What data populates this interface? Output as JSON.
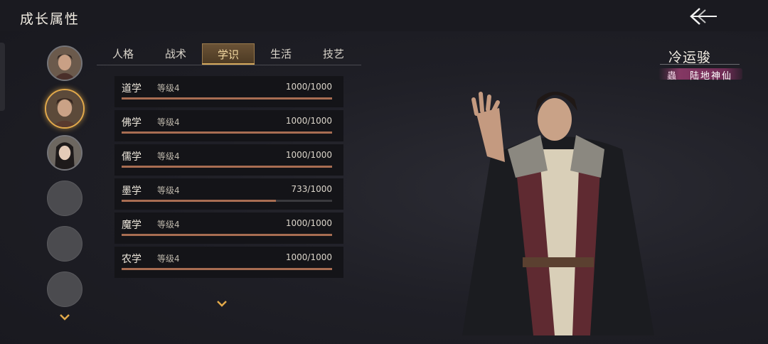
{
  "header": {
    "title": "成长属性"
  },
  "tabs": [
    {
      "label": "人格",
      "active": false
    },
    {
      "label": "战术",
      "active": false
    },
    {
      "label": "学识",
      "active": true
    },
    {
      "label": "生活",
      "active": false
    },
    {
      "label": "技艺",
      "active": false
    }
  ],
  "attributes": [
    {
      "name": "道学",
      "level": "等级4",
      "value": "1000/1000",
      "progress": 1.0
    },
    {
      "name": "佛学",
      "level": "等级4",
      "value": "1000/1000",
      "progress": 1.0
    },
    {
      "name": "儒学",
      "level": "等级4",
      "value": "1000/1000",
      "progress": 1.0
    },
    {
      "name": "墨学",
      "level": "等级4",
      "value": "733/1000",
      "progress": 0.733
    },
    {
      "name": "魔学",
      "level": "等级4",
      "value": "1000/1000",
      "progress": 1.0
    },
    {
      "name": "农学",
      "level": "等级4",
      "value": "1000/1000",
      "progress": 1.0
    }
  ],
  "character": {
    "name": "冷运骏",
    "rank_icon": "蟲",
    "rank_title": "陆地神仙"
  },
  "roster": {
    "selected_index": 1,
    "count": 6
  },
  "colors": {
    "accent": "#e2a94a",
    "progress": "#a86d52",
    "rank": "#963c6e"
  }
}
